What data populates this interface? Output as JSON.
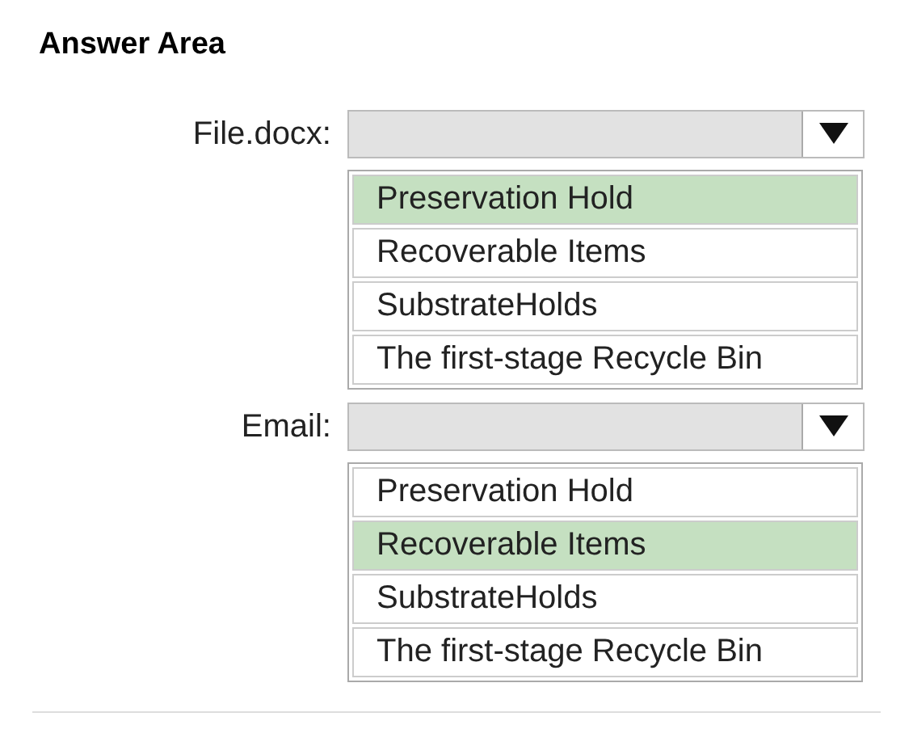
{
  "title": "Answer Area",
  "questions": [
    {
      "label": "File.docx:",
      "options": [
        {
          "text": "Preservation Hold",
          "selected": true
        },
        {
          "text": "Recoverable Items",
          "selected": false
        },
        {
          "text": "SubstrateHolds",
          "selected": false
        },
        {
          "text": "The first-stage Recycle Bin",
          "selected": false
        }
      ]
    },
    {
      "label": "Email:",
      "options": [
        {
          "text": "Preservation Hold",
          "selected": false
        },
        {
          "text": "Recoverable Items",
          "selected": true
        },
        {
          "text": "SubstrateHolds",
          "selected": false
        },
        {
          "text": "The first-stage Recycle Bin",
          "selected": false
        }
      ]
    }
  ]
}
